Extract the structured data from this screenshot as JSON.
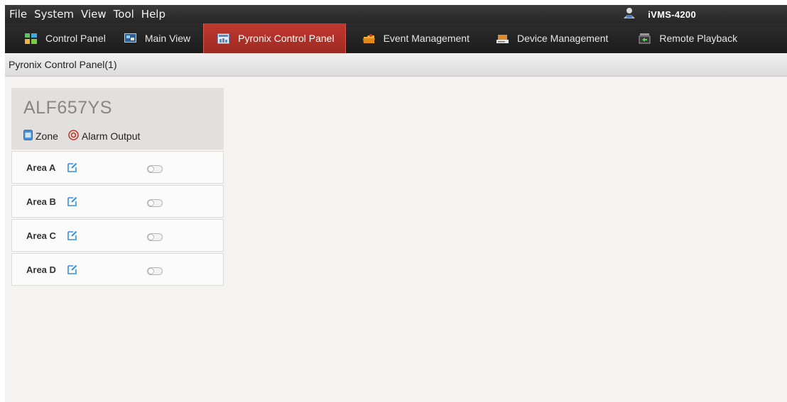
{
  "menu": {
    "items": [
      "File",
      "System",
      "View",
      "Tool",
      "Help"
    ],
    "brand_icon": "user-icon",
    "app_title": "iVMS-4200"
  },
  "tabs": [
    {
      "label": "Control Panel",
      "icon": "grid-icon",
      "active": false
    },
    {
      "label": "Main View",
      "icon": "monitor-icon",
      "active": false
    },
    {
      "label": "Pyronix Control Panel",
      "icon": "panel-icon",
      "active": true
    },
    {
      "label": "Event Management",
      "icon": "folder-icon",
      "active": false
    },
    {
      "label": "Device Management",
      "icon": "device-icon",
      "active": false
    },
    {
      "label": "Remote Playback",
      "icon": "playback-icon",
      "active": false
    }
  ],
  "subheader": {
    "title": "Pyronix Control Panel(1)"
  },
  "panel": {
    "device_name": "ALF657YS",
    "legend": {
      "zone_label": "Zone",
      "alarm_output_label": "Alarm Output"
    },
    "areas": [
      {
        "label": "Area A"
      },
      {
        "label": "Area B"
      },
      {
        "label": "Area C"
      },
      {
        "label": "Area D"
      }
    ]
  },
  "colors": {
    "active_tab": "#b0332a",
    "menubar": "#2e2e2e",
    "content_bg": "#f6f2f1",
    "edit_icon": "#3a8fd8",
    "alarm_icon": "#c0392b"
  }
}
